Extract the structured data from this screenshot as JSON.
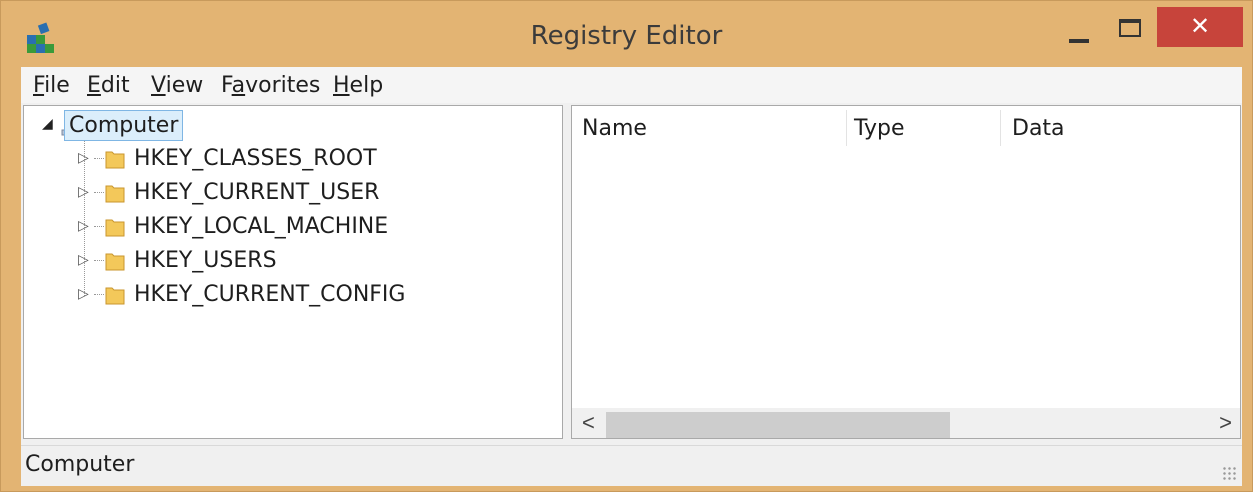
{
  "window": {
    "title": "Registry Editor",
    "close_glyph": "✕",
    "icons": {
      "app": "registry-icon",
      "minimize": "minimize-icon",
      "maximize": "maximize-icon",
      "close": "close-icon"
    }
  },
  "menu": {
    "items": [
      {
        "access_key": "F",
        "rest": "ile"
      },
      {
        "access_key": "E",
        "rest": "dit"
      },
      {
        "access_key": "V",
        "rest": "iew"
      },
      {
        "pre": "F",
        "access_key": "a",
        "rest": "vorites"
      },
      {
        "access_key": "H",
        "rest": "elp"
      }
    ]
  },
  "tree": {
    "root": {
      "label": "Computer",
      "expanded": true,
      "selected": true,
      "expander_glyph": "◢"
    },
    "collapsed_glyph": "▷",
    "hives": [
      {
        "label": "HKEY_CLASSES_ROOT"
      },
      {
        "label": "HKEY_CURRENT_USER"
      },
      {
        "label": "HKEY_LOCAL_MACHINE"
      },
      {
        "label": "HKEY_USERS"
      },
      {
        "label": "HKEY_CURRENT_CONFIG"
      }
    ]
  },
  "list": {
    "columns": [
      "Name",
      "Type",
      "Data"
    ],
    "scroll_left": "<",
    "scroll_right": ">"
  },
  "status": {
    "text": "Computer"
  },
  "colors": {
    "frame": "#e3b473",
    "close": "#c7443b",
    "selection": "#dbeefb"
  }
}
